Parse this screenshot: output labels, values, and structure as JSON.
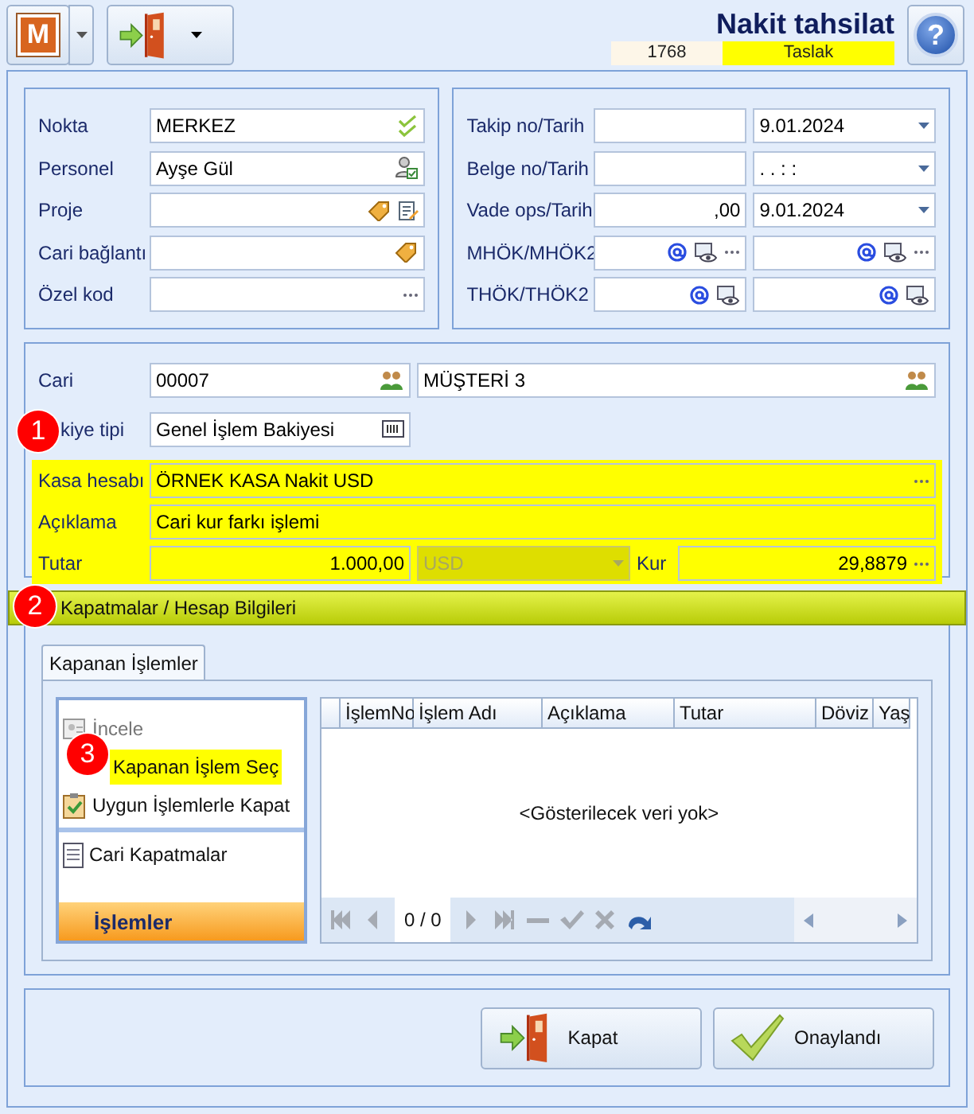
{
  "toolbar": {
    "menu_button": "M",
    "title": "Nakit tahsilat",
    "document_number": "1768",
    "status": "Taslak",
    "help_button": "?"
  },
  "left_fields": [
    {
      "label": "Nokta",
      "value": "MERKEZ"
    },
    {
      "label": "Personel",
      "value": "Ayşe Gül"
    },
    {
      "label": "Proje"
    },
    {
      "label": "Cari bağlantı"
    },
    {
      "label": "Özel kod"
    }
  ],
  "right_fields": [
    {
      "label": "Takip no/Tarih",
      "value_2": "9.01.2024"
    },
    {
      "label": "Belge no/Tarih",
      "value_2": ".  .      :  :"
    },
    {
      "label": "Vade ops/Tarih",
      "value_1": ",00",
      "value_2": "9.01.2024"
    },
    {
      "label": "MHÖK/MHÖK2"
    },
    {
      "label": "THÖK/THÖK2"
    }
  ],
  "cari": {
    "label": "Cari",
    "code": "00007",
    "name": "MÜŞTERİ 3",
    "balance_label": "kiye tipi",
    "balance_type": "Genel İşlem Bakiyesi",
    "cash_account_label": "Kasa hesabı",
    "cash_account": "ÖRNEK KASA Nakit USD",
    "description_label": "Açıklama",
    "description": "Cari kur farkı işlemi",
    "amount_label": "Tutar",
    "amount": "1.000,00",
    "currency": "USD",
    "currency_disabled": true,
    "rate_label": "Kur",
    "rate": "29,8879"
  },
  "callouts": [
    "1",
    "2",
    "3"
  ],
  "section_title": "Kapatmalar / Hesap Bilgileri",
  "tabs": [
    {
      "label": "Kapanan İşlemler",
      "selected": true
    }
  ],
  "actions": [
    {
      "label": "İncele",
      "disabled": true,
      "highlighted": false
    },
    {
      "label": "Kapanan İşlem Seç",
      "disabled": false,
      "highlighted": true
    },
    {
      "label": "Uygun İşlemlerle Kapat",
      "disabled": false,
      "highlighted": false
    }
  ],
  "reports": [
    {
      "label": "Cari Kapatmalar"
    }
  ],
  "actions_footer": "İşlemler",
  "grid": {
    "columns": [
      "İşlemNo",
      "İşlem Adı",
      "Açıklama",
      "Tutar",
      "Döviz",
      "Yaş"
    ],
    "empty_text": "<Gösterilecek veri yok>",
    "navigator": "0 / 0"
  },
  "buttons": [
    {
      "label": "Kapat",
      "kind": "close"
    },
    {
      "label": "Onaylandı",
      "kind": "approve"
    }
  ]
}
